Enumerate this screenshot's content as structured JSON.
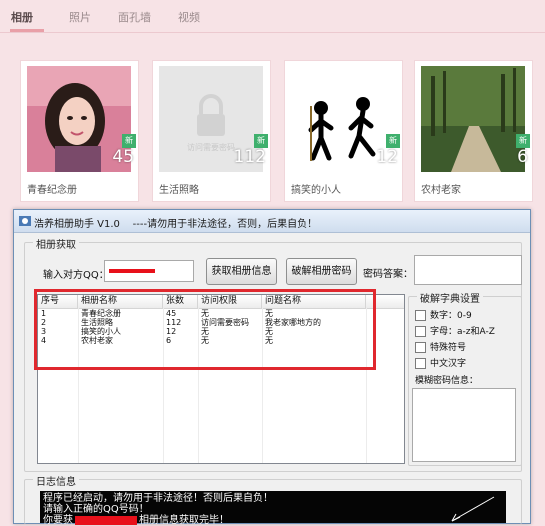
{
  "web": {
    "tabs": [
      "相册",
      "照片",
      "面孔墙",
      "视频"
    ],
    "active_tab": "相册",
    "albums": [
      {
        "name": "青春纪念册",
        "count": "45",
        "badge": "新"
      },
      {
        "name": "生活照略",
        "count": "112",
        "badge": "新",
        "locked_text": "访问需要密码"
      },
      {
        "name": "搞笑的小人",
        "count": "12",
        "badge": "新"
      },
      {
        "name": "农村老家",
        "count": "6",
        "badge": "新"
      }
    ]
  },
  "app": {
    "title": "浩养相册助手 V1.0",
    "title_warning": "----请勿用于非法途径，否则，后果自负！",
    "group_fetch": "相册获取",
    "qq_label": "输入对方QQ：",
    "qq_value": "",
    "btn_fetch": "获取相册信息",
    "btn_crack": "破解相册密码",
    "answer_label": "密码答案：",
    "answer_value": "",
    "columns": [
      "序号",
      "相册名称",
      "张数",
      "访问权限",
      "问题名称"
    ],
    "rows": [
      [
        "1",
        "青春纪念册",
        "45",
        "无",
        "无"
      ],
      [
        "2",
        "生活照略",
        "112",
        "访问需要密码",
        "我老家哪地方的"
      ],
      [
        "3",
        "搞笑的小人",
        "12",
        "无",
        "无"
      ],
      [
        "4",
        "农村老家",
        "6",
        "无",
        "无"
      ]
    ],
    "group_dict": "破解字典设置",
    "dict_options": [
      "数字：0-9",
      "字母：a-z和A-Z",
      "特殊符号",
      "中文汉字"
    ],
    "fuzzy_label": "模糊密码信息：",
    "group_log": "日志信息",
    "log_lines": [
      "程序已经启动，请勿用于非法途径！否则后果自负！",
      "请输入正确的QQ号码！",
      "你要获",
      "相册信息获取完毕！"
    ]
  },
  "colors": {
    "highlight": "#e0282e",
    "badge": "#3fb06d",
    "page_bg": "#f7e3e6"
  }
}
